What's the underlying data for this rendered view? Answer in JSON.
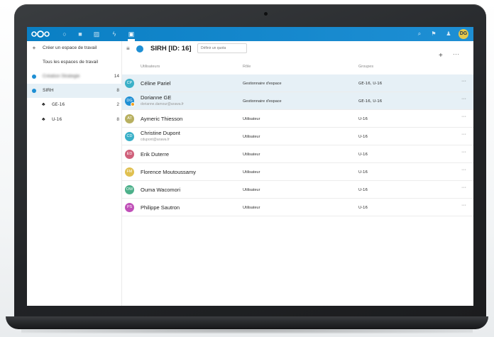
{
  "topbar": {
    "apps": [
      {
        "name": "dashboard-icon",
        "glyph": "○"
      },
      {
        "name": "files-icon",
        "glyph": "■"
      },
      {
        "name": "photos-icon",
        "glyph": "▨"
      },
      {
        "name": "activity-icon",
        "glyph": "ϟ"
      },
      {
        "name": "workspaces-icon",
        "glyph": "▣"
      }
    ],
    "right_icons": [
      {
        "name": "search-icon",
        "glyph": "⌕"
      },
      {
        "name": "notifications-icon",
        "glyph": "⚑"
      },
      {
        "name": "contacts-icon",
        "glyph": "♟"
      }
    ],
    "user_initials": "DG",
    "accent_color": "#0a7fc4"
  },
  "sidebar": {
    "create_label": "Créer un espace de travail",
    "all_spaces_label": "Tous les espaces de travail",
    "spaces": [
      {
        "label": "Création Strategie",
        "count": "14",
        "blurred": true
      },
      {
        "label": "SIRH",
        "count": "8",
        "selected": true
      }
    ],
    "groups": [
      {
        "label": "GE-16",
        "count": "2"
      },
      {
        "label": "U-16",
        "count": "8"
      }
    ]
  },
  "main": {
    "space_title": "SIRH [ID: 16]",
    "quota_placeholder": "Définir un quota",
    "columns": {
      "users": "Utilisateurs",
      "role": "Rôle",
      "groups": "Groupes"
    },
    "users": [
      {
        "initials": "CP",
        "name": "Céline Pariel",
        "email": "",
        "role": "Gestionnaire d'espace",
        "groups": "GE-16, U-16",
        "color": "#3ab0c8",
        "selected": true
      },
      {
        "initials": "DG",
        "name": "Dorianne GE",
        "email": "dorianne.damour@arawa.fr",
        "role": "Gestionnaire d'espace",
        "groups": "GE-16, U-16",
        "color": "#1e8fd4",
        "selected": true,
        "badge": true
      },
      {
        "initials": "AT",
        "name": "Aymeric Thiesson",
        "email": "",
        "role": "Utilisateur",
        "groups": "U-16",
        "color": "#b8b060"
      },
      {
        "initials": "CD",
        "name": "Christine Dupont",
        "email": "cdupont@arawa.fr",
        "role": "Utilisateur",
        "groups": "U-16",
        "color": "#3ab0c8"
      },
      {
        "initials": "ED",
        "name": "Erik Duterre",
        "email": "",
        "role": "Utilisateur",
        "groups": "U-16",
        "color": "#d0607a"
      },
      {
        "initials": "FM",
        "name": "Florence Moutoussamy",
        "email": "",
        "role": "Utilisateur",
        "groups": "U-16",
        "color": "#e0c050"
      },
      {
        "initials": "OW",
        "name": "Ouma Wacomori",
        "email": "",
        "role": "Utilisateur",
        "groups": "U-16",
        "color": "#4cb08a"
      },
      {
        "initials": "PS",
        "name": "Philippe Sautron",
        "email": "",
        "role": "Utilisateur",
        "groups": "U-16",
        "color": "#c050b8"
      }
    ]
  }
}
